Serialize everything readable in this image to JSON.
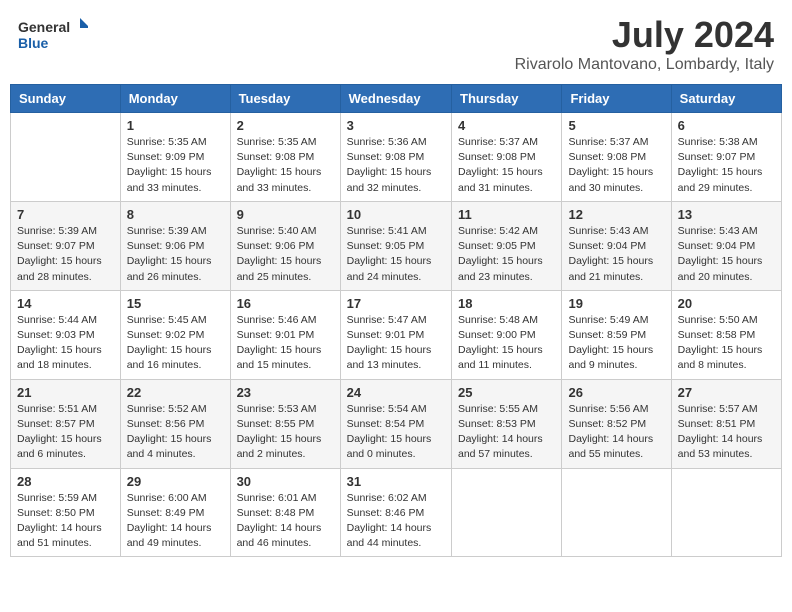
{
  "header": {
    "logo_line1": "General",
    "logo_line2": "Blue",
    "title": "July 2024",
    "subtitle": "Rivarolo Mantovano, Lombardy, Italy"
  },
  "days_of_week": [
    "Sunday",
    "Monday",
    "Tuesday",
    "Wednesday",
    "Thursday",
    "Friday",
    "Saturday"
  ],
  "weeks": [
    [
      {
        "day": "",
        "sunrise": "",
        "sunset": "",
        "daylight": ""
      },
      {
        "day": "1",
        "sunrise": "Sunrise: 5:35 AM",
        "sunset": "Sunset: 9:09 PM",
        "daylight": "Daylight: 15 hours and 33 minutes."
      },
      {
        "day": "2",
        "sunrise": "Sunrise: 5:35 AM",
        "sunset": "Sunset: 9:08 PM",
        "daylight": "Daylight: 15 hours and 33 minutes."
      },
      {
        "day": "3",
        "sunrise": "Sunrise: 5:36 AM",
        "sunset": "Sunset: 9:08 PM",
        "daylight": "Daylight: 15 hours and 32 minutes."
      },
      {
        "day": "4",
        "sunrise": "Sunrise: 5:37 AM",
        "sunset": "Sunset: 9:08 PM",
        "daylight": "Daylight: 15 hours and 31 minutes."
      },
      {
        "day": "5",
        "sunrise": "Sunrise: 5:37 AM",
        "sunset": "Sunset: 9:08 PM",
        "daylight": "Daylight: 15 hours and 30 minutes."
      },
      {
        "day": "6",
        "sunrise": "Sunrise: 5:38 AM",
        "sunset": "Sunset: 9:07 PM",
        "daylight": "Daylight: 15 hours and 29 minutes."
      }
    ],
    [
      {
        "day": "7",
        "sunrise": "Sunrise: 5:39 AM",
        "sunset": "Sunset: 9:07 PM",
        "daylight": "Daylight: 15 hours and 28 minutes."
      },
      {
        "day": "8",
        "sunrise": "Sunrise: 5:39 AM",
        "sunset": "Sunset: 9:06 PM",
        "daylight": "Daylight: 15 hours and 26 minutes."
      },
      {
        "day": "9",
        "sunrise": "Sunrise: 5:40 AM",
        "sunset": "Sunset: 9:06 PM",
        "daylight": "Daylight: 15 hours and 25 minutes."
      },
      {
        "day": "10",
        "sunrise": "Sunrise: 5:41 AM",
        "sunset": "Sunset: 9:05 PM",
        "daylight": "Daylight: 15 hours and 24 minutes."
      },
      {
        "day": "11",
        "sunrise": "Sunrise: 5:42 AM",
        "sunset": "Sunset: 9:05 PM",
        "daylight": "Daylight: 15 hours and 23 minutes."
      },
      {
        "day": "12",
        "sunrise": "Sunrise: 5:43 AM",
        "sunset": "Sunset: 9:04 PM",
        "daylight": "Daylight: 15 hours and 21 minutes."
      },
      {
        "day": "13",
        "sunrise": "Sunrise: 5:43 AM",
        "sunset": "Sunset: 9:04 PM",
        "daylight": "Daylight: 15 hours and 20 minutes."
      }
    ],
    [
      {
        "day": "14",
        "sunrise": "Sunrise: 5:44 AM",
        "sunset": "Sunset: 9:03 PM",
        "daylight": "Daylight: 15 hours and 18 minutes."
      },
      {
        "day": "15",
        "sunrise": "Sunrise: 5:45 AM",
        "sunset": "Sunset: 9:02 PM",
        "daylight": "Daylight: 15 hours and 16 minutes."
      },
      {
        "day": "16",
        "sunrise": "Sunrise: 5:46 AM",
        "sunset": "Sunset: 9:01 PM",
        "daylight": "Daylight: 15 hours and 15 minutes."
      },
      {
        "day": "17",
        "sunrise": "Sunrise: 5:47 AM",
        "sunset": "Sunset: 9:01 PM",
        "daylight": "Daylight: 15 hours and 13 minutes."
      },
      {
        "day": "18",
        "sunrise": "Sunrise: 5:48 AM",
        "sunset": "Sunset: 9:00 PM",
        "daylight": "Daylight: 15 hours and 11 minutes."
      },
      {
        "day": "19",
        "sunrise": "Sunrise: 5:49 AM",
        "sunset": "Sunset: 8:59 PM",
        "daylight": "Daylight: 15 hours and 9 minutes."
      },
      {
        "day": "20",
        "sunrise": "Sunrise: 5:50 AM",
        "sunset": "Sunset: 8:58 PM",
        "daylight": "Daylight: 15 hours and 8 minutes."
      }
    ],
    [
      {
        "day": "21",
        "sunrise": "Sunrise: 5:51 AM",
        "sunset": "Sunset: 8:57 PM",
        "daylight": "Daylight: 15 hours and 6 minutes."
      },
      {
        "day": "22",
        "sunrise": "Sunrise: 5:52 AM",
        "sunset": "Sunset: 8:56 PM",
        "daylight": "Daylight: 15 hours and 4 minutes."
      },
      {
        "day": "23",
        "sunrise": "Sunrise: 5:53 AM",
        "sunset": "Sunset: 8:55 PM",
        "daylight": "Daylight: 15 hours and 2 minutes."
      },
      {
        "day": "24",
        "sunrise": "Sunrise: 5:54 AM",
        "sunset": "Sunset: 8:54 PM",
        "daylight": "Daylight: 15 hours and 0 minutes."
      },
      {
        "day": "25",
        "sunrise": "Sunrise: 5:55 AM",
        "sunset": "Sunset: 8:53 PM",
        "daylight": "Daylight: 14 hours and 57 minutes."
      },
      {
        "day": "26",
        "sunrise": "Sunrise: 5:56 AM",
        "sunset": "Sunset: 8:52 PM",
        "daylight": "Daylight: 14 hours and 55 minutes."
      },
      {
        "day": "27",
        "sunrise": "Sunrise: 5:57 AM",
        "sunset": "Sunset: 8:51 PM",
        "daylight": "Daylight: 14 hours and 53 minutes."
      }
    ],
    [
      {
        "day": "28",
        "sunrise": "Sunrise: 5:59 AM",
        "sunset": "Sunset: 8:50 PM",
        "daylight": "Daylight: 14 hours and 51 minutes."
      },
      {
        "day": "29",
        "sunrise": "Sunrise: 6:00 AM",
        "sunset": "Sunset: 8:49 PM",
        "daylight": "Daylight: 14 hours and 49 minutes."
      },
      {
        "day": "30",
        "sunrise": "Sunrise: 6:01 AM",
        "sunset": "Sunset: 8:48 PM",
        "daylight": "Daylight: 14 hours and 46 minutes."
      },
      {
        "day": "31",
        "sunrise": "Sunrise: 6:02 AM",
        "sunset": "Sunset: 8:46 PM",
        "daylight": "Daylight: 14 hours and 44 minutes."
      },
      {
        "day": "",
        "sunrise": "",
        "sunset": "",
        "daylight": ""
      },
      {
        "day": "",
        "sunrise": "",
        "sunset": "",
        "daylight": ""
      },
      {
        "day": "",
        "sunrise": "",
        "sunset": "",
        "daylight": ""
      }
    ]
  ]
}
